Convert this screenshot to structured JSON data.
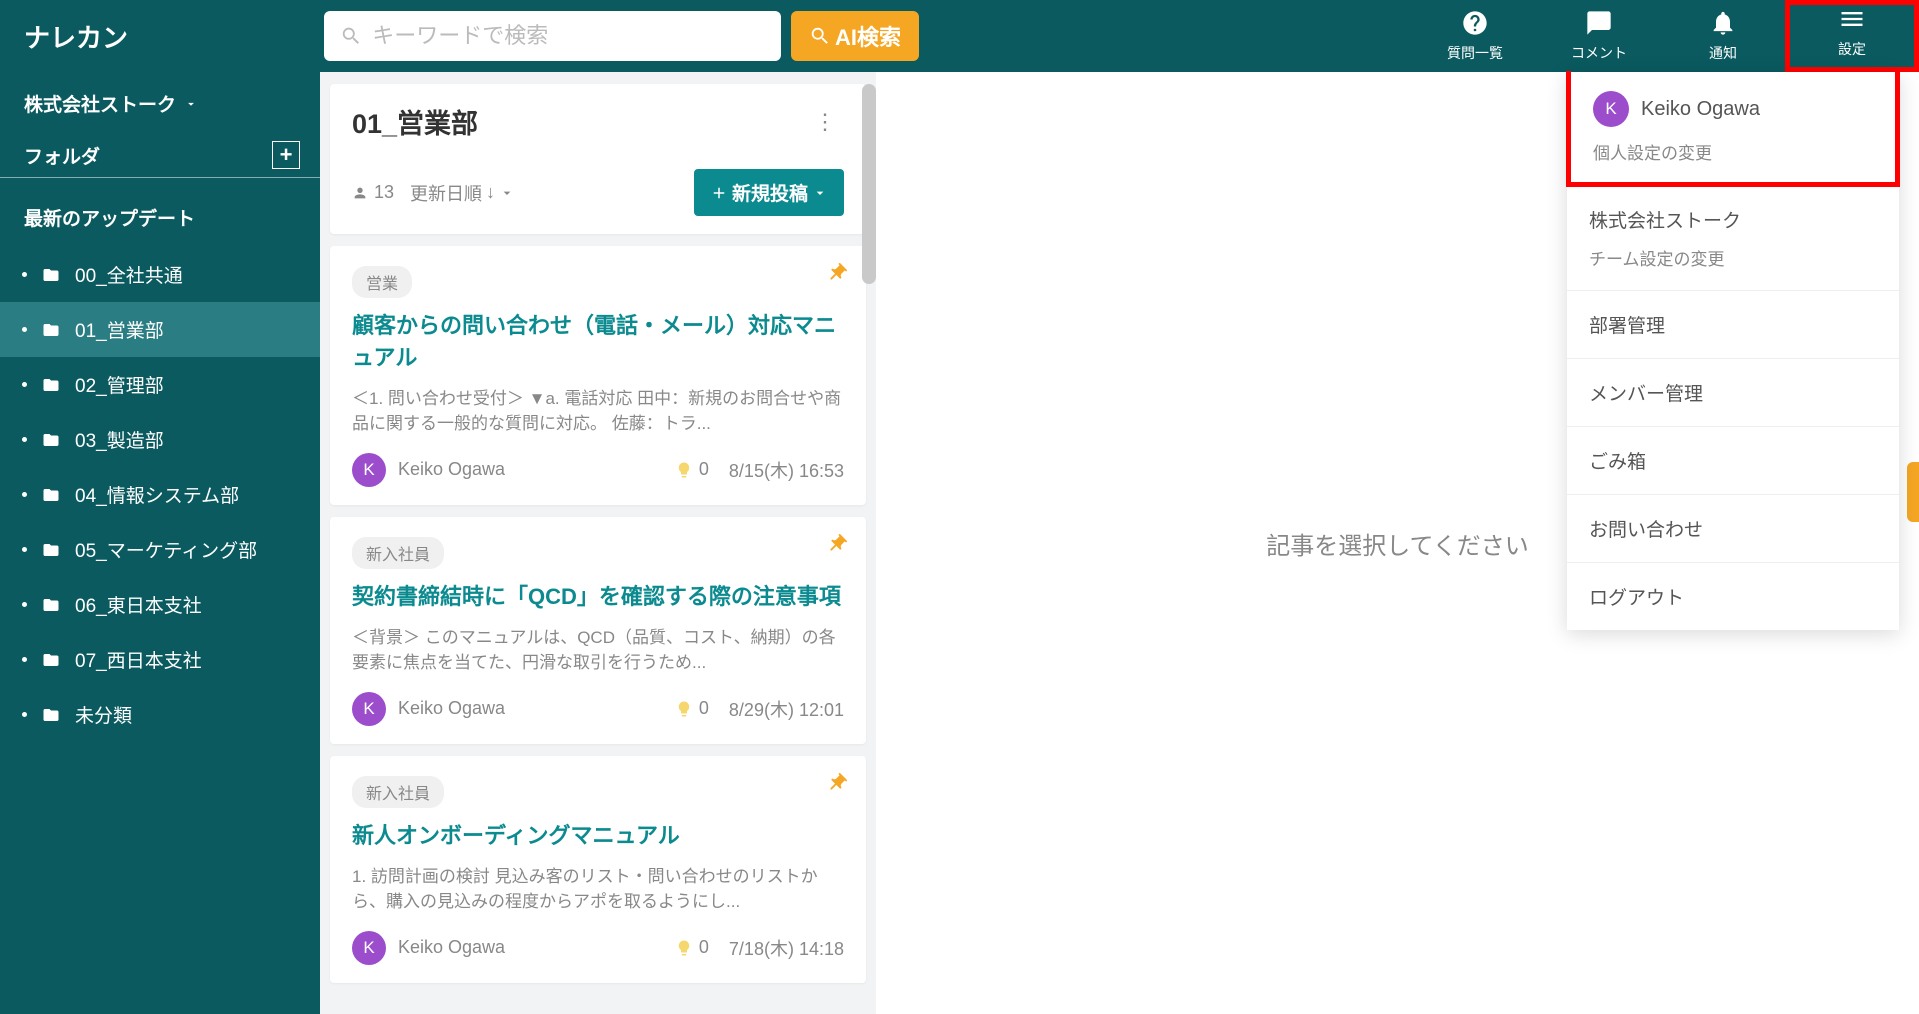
{
  "header": {
    "logo": "ナレカン",
    "search_placeholder": "キーワードで検索",
    "ai_search": "AI検索",
    "icons": {
      "questions": "質問一覧",
      "comments": "コメント",
      "notifications": "通知",
      "settings": "設定"
    }
  },
  "sidebar": {
    "workspace": "株式会社ストーク",
    "folder_label": "フォルダ",
    "update_label": "最新のアップデート",
    "folders": [
      {
        "name": "00_全社共通",
        "active": false
      },
      {
        "name": "01_営業部",
        "active": true
      },
      {
        "name": "02_管理部",
        "active": false
      },
      {
        "name": "03_製造部",
        "active": false
      },
      {
        "name": "04_情報システム部",
        "active": false
      },
      {
        "name": "05_マーケティング部",
        "active": false
      },
      {
        "name": "06_東日本支社",
        "active": false
      },
      {
        "name": "07_西日本支社",
        "active": false
      },
      {
        "name": "未分類",
        "active": false
      }
    ]
  },
  "list": {
    "title": "01_営業部",
    "count": "13",
    "sort": "更新日順",
    "new_post": "新規投稿",
    "cards": [
      {
        "tag": "営業",
        "title": "顧客からの問い合わせ（電話・メール）対応マニュアル",
        "excerpt": "＜1. 問い合わせ受付＞ ▼a. 電話対応 田中：新規のお問合せや商品に関する一般的な質問に対応。 佐藤：トラ...",
        "author_initial": "K",
        "author": "Keiko Ogawa",
        "bulbs": "0",
        "date": "8/15(木) 16:53",
        "pinned": true
      },
      {
        "tag": "新入社員",
        "title": "契約書締結時に「QCD」を確認する際の注意事項",
        "excerpt": "＜背景＞ このマニュアルは、QCD（品質、コスト、納期）の各要素に焦点を当てた、円滑な取引を行うため...",
        "author_initial": "K",
        "author": "Keiko Ogawa",
        "bulbs": "0",
        "date": "8/29(木) 12:01",
        "pinned": true
      },
      {
        "tag": "新入社員",
        "title": "新人オンボーディングマニュアル",
        "excerpt": "1. 訪問計画の検討 見込み客のリスト・問い合わせのリストから、購入の見込みの程度からアポを取るようにし...",
        "author_initial": "K",
        "author": "Keiko Ogawa",
        "bulbs": "0",
        "date": "7/18(木) 14:18",
        "pinned": true
      }
    ]
  },
  "detail": {
    "placeholder": "記事を選択してください"
  },
  "settings_menu": {
    "user_initial": "K",
    "user_name": "Keiko Ogawa",
    "personal": "個人設定の変更",
    "team_name": "株式会社ストーク",
    "team": "チーム設定の変更",
    "items": [
      "部署管理",
      "メンバー管理",
      "ごみ箱",
      "お問い合わせ",
      "ログアウト"
    ]
  }
}
